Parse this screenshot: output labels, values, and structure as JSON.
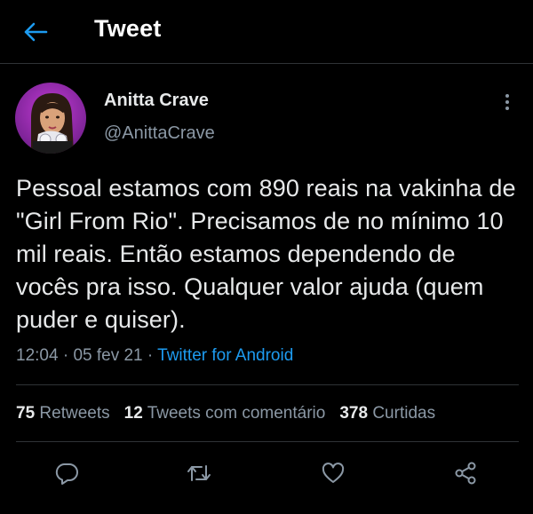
{
  "header": {
    "title": "Tweet",
    "back_icon": "arrow-left-icon",
    "accent": "#1d9bf0"
  },
  "tweet": {
    "author_name": "Anitta Crave",
    "author_handle": "@AnittaCrave",
    "text": "Pessoal estamos com 890 reais na vakinha de \"Girl From Rio\". Precisamos de no mínimo 10 mil reais. Então estamos dependendo de vocês pra isso. Qualquer valor ajuda (quem puder e quiser).",
    "time": "12:04",
    "separator": " · ",
    "date": "05 fev 21",
    "source": "Twitter for Android"
  },
  "stats": {
    "retweets_count": "75",
    "retweets_label": "Retweets",
    "comments_count": "12",
    "comments_label": "Tweets com comentário",
    "likes_count": "378",
    "likes_label": "Curtidas"
  },
  "actions": [
    "reply-icon",
    "retweet-icon",
    "like-icon",
    "share-icon"
  ]
}
